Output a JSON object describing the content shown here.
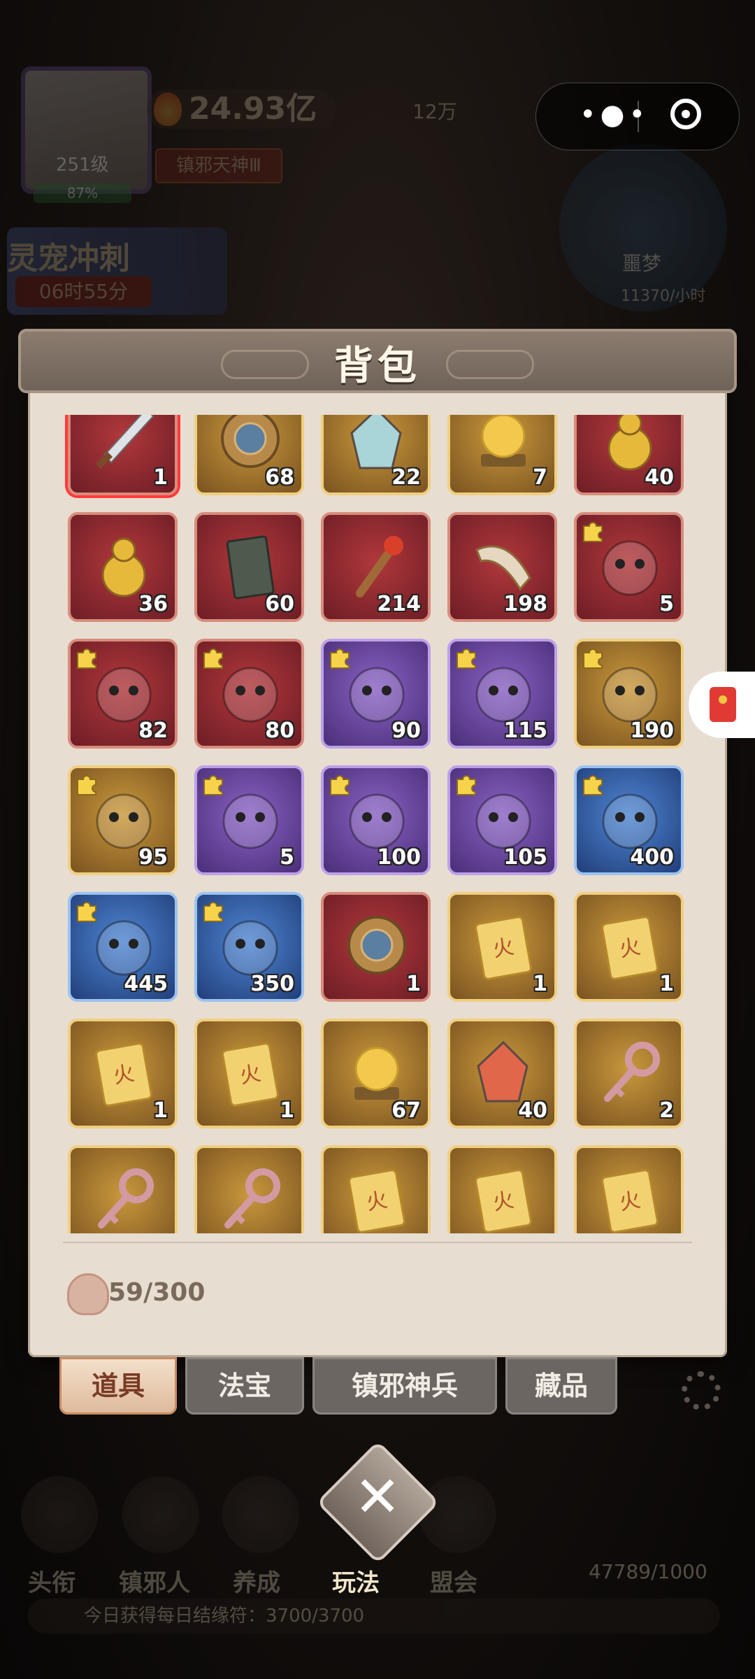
{
  "hud": {
    "level": "251级",
    "level_progress": "87%",
    "power": "24.93亿",
    "gold": "12万",
    "title_badge": "镇邪天神Ⅲ",
    "event_title": "灵宠冲刺",
    "event_timer": "06时55分",
    "dream_label": "噩梦",
    "dream_rate": "11370/小时"
  },
  "panel": {
    "title": "背包",
    "capacity": "59/300"
  },
  "items": [
    {
      "qty": "1",
      "frame": "red",
      "icon": "sword-icon",
      "selected": true,
      "pet": false
    },
    {
      "qty": "68",
      "frame": "gold",
      "icon": "octagon-mirror-icon",
      "selected": false,
      "pet": false
    },
    {
      "qty": "22",
      "frame": "gold",
      "icon": "crystal-icon",
      "selected": false,
      "pet": false
    },
    {
      "qty": "7",
      "frame": "gold",
      "icon": "pearl-stand-icon",
      "selected": false,
      "pet": false
    },
    {
      "qty": "40",
      "frame": "red",
      "icon": "lantern-jar-icon",
      "selected": false,
      "pet": false
    },
    {
      "qty": "36",
      "frame": "red",
      "icon": "gourd-icon",
      "selected": false,
      "pet": false
    },
    {
      "qty": "60",
      "frame": "red",
      "icon": "talisman-tag-icon",
      "selected": false,
      "pet": false
    },
    {
      "qty": "214",
      "frame": "red",
      "icon": "scepter-icon",
      "selected": false,
      "pet": false
    },
    {
      "qty": "198",
      "frame": "red",
      "icon": "horn-icon",
      "selected": false,
      "pet": false
    },
    {
      "qty": "5",
      "frame": "red",
      "icon": "duck-pet-icon",
      "selected": false,
      "pet": true
    },
    {
      "qty": "82",
      "frame": "red",
      "icon": "panda-pet-icon",
      "selected": false,
      "pet": true
    },
    {
      "qty": "80",
      "frame": "red",
      "icon": "golden-dragon-pet-icon",
      "selected": false,
      "pet": true
    },
    {
      "qty": "90",
      "frame": "purple",
      "icon": "spirit-beast-pet-icon",
      "selected": false,
      "pet": true
    },
    {
      "qty": "115",
      "frame": "purple",
      "icon": "armored-cat-pet-icon",
      "selected": false,
      "pet": true
    },
    {
      "qty": "190",
      "frame": "gold",
      "icon": "capybara-pet-icon",
      "selected": false,
      "pet": true
    },
    {
      "qty": "95",
      "frame": "gold",
      "icon": "mushroom-pet-icon",
      "selected": false,
      "pet": true
    },
    {
      "qty": "5",
      "frame": "purple",
      "icon": "eye-sword-pet-icon",
      "selected": false,
      "pet": true
    },
    {
      "qty": "100",
      "frame": "purple",
      "icon": "ghost-banner-pet-icon",
      "selected": false,
      "pet": true
    },
    {
      "qty": "105",
      "frame": "purple",
      "icon": "incense-burner-pet-icon",
      "selected": false,
      "pet": true
    },
    {
      "qty": "400",
      "frame": "blue",
      "icon": "red-octopus-pet-icon",
      "selected": false,
      "pet": true
    },
    {
      "qty": "445",
      "frame": "blue",
      "icon": "lantern-demon-pet-icon",
      "selected": false,
      "pet": true
    },
    {
      "qty": "350",
      "frame": "blue",
      "icon": "green-mask-pet-icon",
      "selected": false,
      "pet": true
    },
    {
      "qty": "1",
      "frame": "red",
      "icon": "round-mirror-icon",
      "selected": false,
      "pet": false
    },
    {
      "qty": "1",
      "frame": "gold",
      "icon": "fire-talisman-icon",
      "selected": false,
      "pet": false
    },
    {
      "qty": "1",
      "frame": "gold",
      "icon": "fire-talisman-icon",
      "selected": false,
      "pet": false
    },
    {
      "qty": "1",
      "frame": "gold",
      "icon": "fire-talisman-icon",
      "selected": false,
      "pet": false
    },
    {
      "qty": "1",
      "frame": "gold",
      "icon": "fire-talisman-icon",
      "selected": false,
      "pet": false
    },
    {
      "qty": "67",
      "frame": "gold",
      "icon": "golden-orb-icon",
      "selected": false,
      "pet": false
    },
    {
      "qty": "40",
      "frame": "gold",
      "icon": "ore-icon",
      "selected": false,
      "pet": false
    },
    {
      "qty": "2",
      "frame": "gold",
      "icon": "key-icon",
      "selected": false,
      "pet": false
    },
    {
      "qty": "",
      "frame": "gold",
      "icon": "key-icon",
      "selected": false,
      "pet": false
    },
    {
      "qty": "",
      "frame": "gold",
      "icon": "key-icon",
      "selected": false,
      "pet": false
    },
    {
      "qty": "",
      "frame": "gold",
      "icon": "fire-talisman-icon",
      "selected": false,
      "pet": false
    },
    {
      "qty": "",
      "frame": "gold",
      "icon": "fire-talisman-icon",
      "selected": false,
      "pet": false
    },
    {
      "qty": "",
      "frame": "gold",
      "icon": "fire-talisman-icon",
      "selected": false,
      "pet": false
    }
  ],
  "tabs": [
    {
      "label": "道具",
      "active": true
    },
    {
      "label": "法宝",
      "active": false
    },
    {
      "label": "镇邪神兵",
      "active": false
    },
    {
      "label": "藏品",
      "active": false
    }
  ],
  "bottom_nav": {
    "items": [
      "头衔",
      "镇邪人",
      "养成",
      "玩法",
      "盟会"
    ],
    "token_count": "47789/1000",
    "daily_text": "今日获得每日结缘符：3700/3700"
  },
  "talisman_char": "火",
  "colors": {
    "red_frame": "#b0383c",
    "gold_frame": "#c9983c",
    "purple_frame": "#8a62c4",
    "blue_frame": "#4f86d2",
    "panel_bg": "#e7ddd1"
  }
}
